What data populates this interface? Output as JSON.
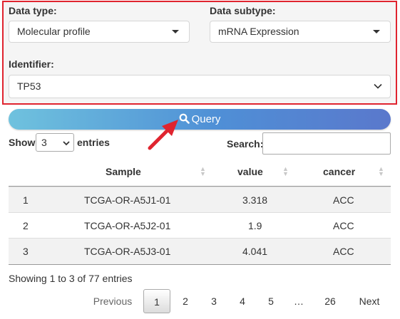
{
  "form": {
    "data_type_label": "Data type:",
    "data_type_value": "Molecular profile",
    "data_subtype_label": "Data subtype:",
    "data_subtype_value": "mRNA Expression",
    "identifier_label": "Identifier:",
    "identifier_value": "TP53"
  },
  "query_button": {
    "label": "Query",
    "icon": "search-icon"
  },
  "table_controls": {
    "show_label": "Show",
    "entries_value": "3",
    "entries_label": "entries",
    "search_label": "Search:",
    "search_value": ""
  },
  "table": {
    "columns": [
      "",
      "Sample",
      "value",
      "cancer"
    ],
    "rows": [
      {
        "index": "1",
        "sample": "TCGA-OR-A5J1-01",
        "value": "3.318",
        "cancer": "ACC"
      },
      {
        "index": "2",
        "sample": "TCGA-OR-A5J2-01",
        "value": "1.9",
        "cancer": "ACC"
      },
      {
        "index": "3",
        "sample": "TCGA-OR-A5J3-01",
        "value": "4.041",
        "cancer": "ACC"
      }
    ]
  },
  "footer": {
    "info": "Showing 1 to 3 of 77 entries",
    "pagination": {
      "previous": "Previous",
      "pages": [
        "1",
        "2",
        "3",
        "4",
        "5",
        "…",
        "26"
      ],
      "next": "Next",
      "current": "1"
    }
  },
  "colors": {
    "highlight_border": "#e0242f",
    "annotation_arrow": "#e0242f",
    "query_gradient_start": "#6fc2de",
    "query_gradient_end": "#5a78cc"
  }
}
